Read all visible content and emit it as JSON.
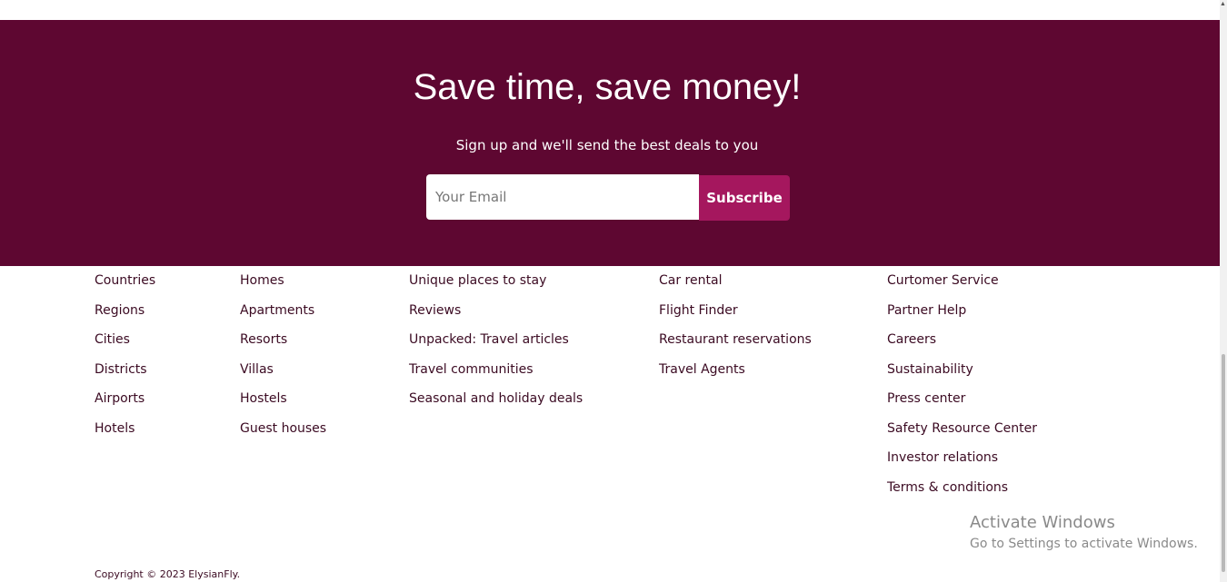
{
  "newsletter": {
    "title": "Save time, save money!",
    "subtitle": "Sign up and we'll send the best deals to you",
    "email_placeholder": "Your Email",
    "subscribe_label": "Subscribe"
  },
  "footer": {
    "columns": [
      [
        "Countries",
        "Regions",
        "Cities",
        "Districts",
        "Airports",
        "Hotels"
      ],
      [
        "Homes",
        "Apartments",
        "Resorts",
        "Villas",
        "Hostels",
        "Guest houses"
      ],
      [
        "Unique places to stay",
        "Reviews",
        "Unpacked: Travel articles",
        "Travel communities",
        "Seasonal and holiday deals"
      ],
      [
        "Car rental",
        "Flight Finder",
        "Restaurant reservations",
        "Travel Agents"
      ],
      [
        "Curtomer Service",
        "Partner Help",
        "Careers",
        "Sustainability",
        "Press center",
        "Safety Resource Center",
        "Investor relations",
        "Terms & conditions"
      ]
    ],
    "copyright": "Copyright © 2023 ElysianFly."
  },
  "os_overlay": {
    "activate_title": "Activate Windows",
    "activate_subtitle": "Go to Settings to activate Windows."
  },
  "colors": {
    "hero_background": "#5e0731",
    "subscribe_button": "#a5175e",
    "link_text": "#3b0a22"
  }
}
